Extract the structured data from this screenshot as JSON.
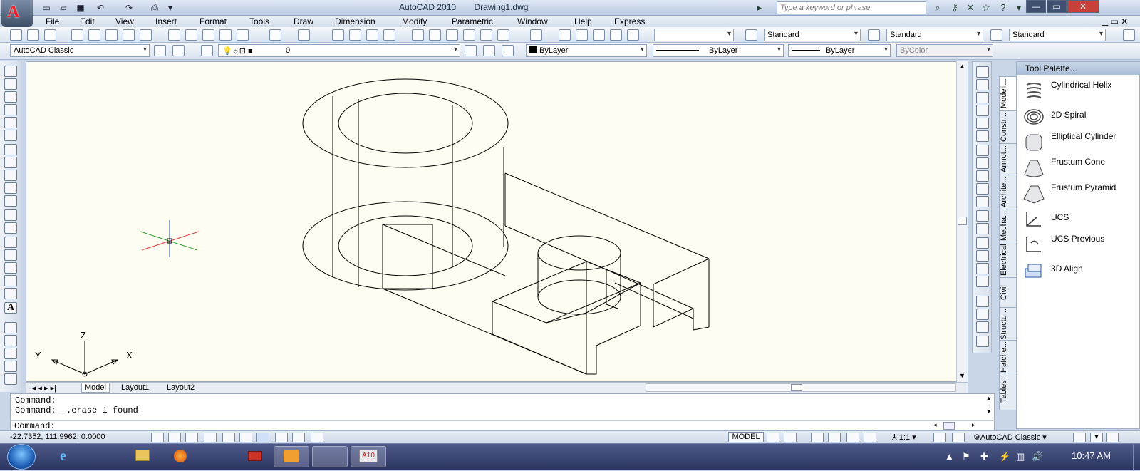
{
  "app": {
    "title": "AutoCAD 2010",
    "document": "Drawing1.dwg",
    "search_placeholder": "Type a keyword or phrase",
    "logo": "A"
  },
  "menu": [
    "File",
    "Edit",
    "View",
    "Insert",
    "Format",
    "Tools",
    "Draw",
    "Dimension",
    "Modify",
    "Parametric",
    "Window",
    "Help",
    "Express"
  ],
  "toolbar_styles": {
    "text_style": "Standard",
    "dim_style": "Standard",
    "table_style": "Standard"
  },
  "workspace_bar": {
    "workspace": "AutoCAD Classic",
    "layer": "0",
    "color": "ByLayer",
    "linetype": "ByLayer",
    "lineweight": "ByLayer",
    "plotstyle": "ByColor"
  },
  "ucs_icon": {
    "x": "X",
    "y": "Y",
    "z": "Z"
  },
  "layout_tabs": [
    "Model",
    "Layout1",
    "Layout2"
  ],
  "palette": {
    "title": "Tool Palette...",
    "tabs": [
      "Modeli...",
      "Constr...",
      "Annot...",
      "Archite...",
      "Mecha...",
      "Electrical",
      "Civil",
      "Structu...",
      "Hatche...",
      "Tables"
    ],
    "items": [
      {
        "label": "Cylindrical Helix",
        "icon": "helix-icon"
      },
      {
        "label": "2D Spiral",
        "icon": "spiral-icon"
      },
      {
        "label": "Elliptical Cylinder",
        "icon": "elliptical-cylinder-icon"
      },
      {
        "label": "Frustum Cone",
        "icon": "frustum-cone-icon"
      },
      {
        "label": "Frustum Pyramid",
        "icon": "frustum-pyramid-icon"
      },
      {
        "label": "UCS",
        "icon": "ucs-icon"
      },
      {
        "label": "UCS Previous",
        "icon": "ucs-previous-icon"
      },
      {
        "label": "3D Align",
        "icon": "3d-align-icon"
      }
    ]
  },
  "command_line": {
    "history": [
      "Command:",
      "Command: _.erase 1 found"
    ],
    "prompt": "Command:"
  },
  "status": {
    "coords": "-22.7352, 111.9962, 0.0000",
    "model": "MODEL",
    "scale": "1:1",
    "workspace": "AutoCAD Classic"
  },
  "taskbar": {
    "time": "10:47 AM",
    "active_app": "A10"
  }
}
